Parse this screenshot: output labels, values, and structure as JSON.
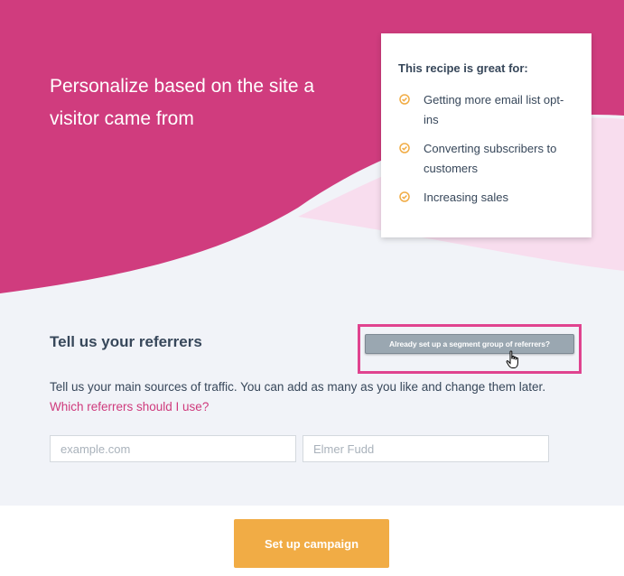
{
  "hero": {
    "title": "Personalize based on the site a visitor came from"
  },
  "recipe_card": {
    "title": "This recipe is great for:",
    "items": [
      {
        "label": "Getting more email list opt-ins",
        "icon": "check-circle-icon"
      },
      {
        "label": "Converting subscribers to customers",
        "icon": "check-circle-icon"
      },
      {
        "label": "Increasing sales",
        "icon": "check-circle-icon"
      }
    ]
  },
  "referrers": {
    "heading": "Tell us your referrers",
    "segment_button_label": "Already set up a segment group of referrers?",
    "description": "Tell us your main sources of traffic. You can add as many as you like and change them later.",
    "help_link": "Which referrers should I use?",
    "url_field": {
      "value": "",
      "placeholder": "example.com"
    },
    "name_field": {
      "value": "",
      "placeholder": "Elmer Fudd"
    }
  },
  "footer": {
    "cta_label": "Set up campaign"
  },
  "colors": {
    "brand_pink": "#d03c7e",
    "light_pink": "#f8ddee",
    "page_bg": "#f1f3f8",
    "accent_orange": "#f1ac45",
    "highlight_border": "#e0438f",
    "button_gray": "#9aa7b1",
    "text": "#37475a",
    "link": "#cf3a7c"
  }
}
